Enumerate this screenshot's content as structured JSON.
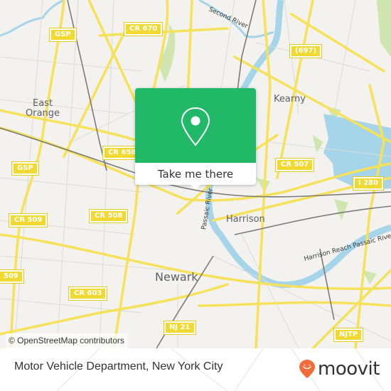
{
  "map": {
    "road_shields": [
      {
        "id": "gsp-top",
        "label": "GSP"
      },
      {
        "id": "cr670",
        "label": "CR 670"
      },
      {
        "id": "cr697",
        "label": "(697)"
      },
      {
        "id": "cr658",
        "label": "CR 658"
      },
      {
        "id": "gsp-left",
        "label": "GSP"
      },
      {
        "id": "cr507",
        "label": "CR 507"
      },
      {
        "id": "i280",
        "label": "I 280"
      },
      {
        "id": "cr509-a",
        "label": "CR 509"
      },
      {
        "id": "cr508",
        "label": "CR 508"
      },
      {
        "id": "cr509-b",
        "label": "509"
      },
      {
        "id": "cr603",
        "label": "CR 603"
      },
      {
        "id": "nj21",
        "label": "NJ 21"
      },
      {
        "id": "njtp",
        "label": "NJTP"
      }
    ],
    "places": {
      "east_orange": "East\nOrange",
      "kearny": "Kearny",
      "harrison": "Harrison",
      "newark": "Newark"
    },
    "water_labels": {
      "second_river": "Second River",
      "passaic_river": "Passaic River",
      "harrison_reach": "Harrison Reach Passaic River"
    },
    "colors": {
      "background": "#f3f2ee",
      "road": "#f5e25a",
      "water": "#a6d5ea",
      "park": "#cfe6b0",
      "rail": "#7a7a7a"
    }
  },
  "popup": {
    "icon": "map-pin-icon",
    "button_label": "Take me there",
    "accent": "#21b868"
  },
  "attribution": "© OpenStreetMap contributors",
  "footer": {
    "title": "Motor Vehicle Department, New York City",
    "brand": {
      "name": "moovit",
      "icon": "moovit-pin-smile-icon",
      "color": "#f26b3a"
    }
  }
}
